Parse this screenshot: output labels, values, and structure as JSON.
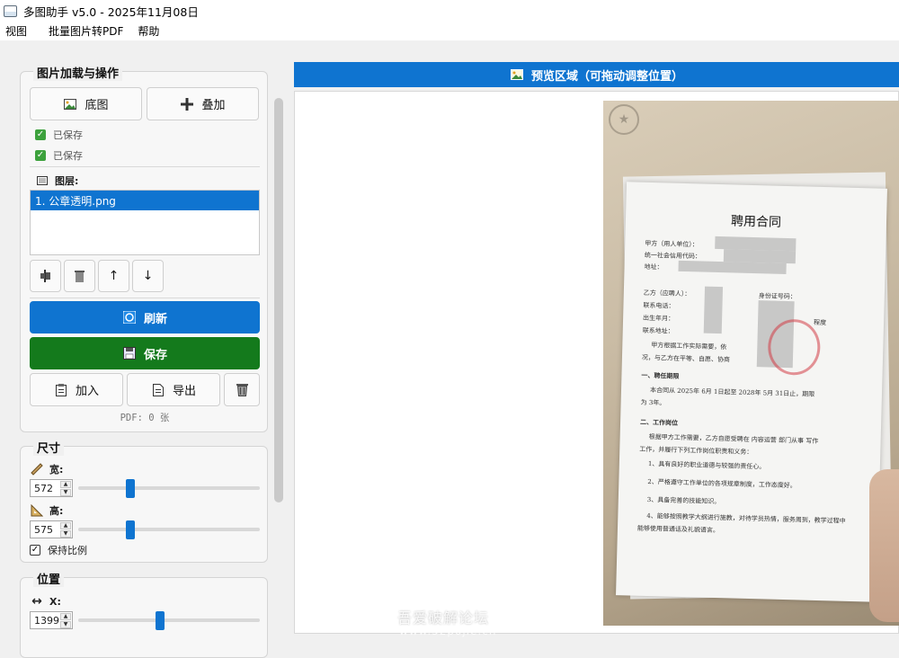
{
  "window": {
    "title": "多图助手 v5.0 - 2025年11月08日"
  },
  "menu": [
    "视图",
    "批量图片转PDF",
    "帮助"
  ],
  "ops_group": {
    "title": "图片加载与操作",
    "base_label": "底图",
    "overlay_label": "叠加",
    "saved_1": "已保存",
    "saved_2": "已保存",
    "layers_label": "图层:",
    "layers": [
      "1. 公章透明.png"
    ],
    "refresh_label": "刷新",
    "save_label": "保存",
    "add_label": "加入",
    "export_label": "导出",
    "pdf_count": "PDF: 0 张"
  },
  "size_group": {
    "title": "尺寸",
    "width_label": "宽:",
    "width_value": "572",
    "width_slider_fraction": 0.29,
    "height_label": "高:",
    "height_value": "575",
    "height_slider_fraction": 0.29,
    "keep_ratio_label": "保持比例",
    "keep_ratio_checked": true
  },
  "position_group": {
    "title": "位置",
    "x_label": "X:",
    "x_value": "1399",
    "x_slider_fraction": 0.45
  },
  "preview": {
    "header": "预览区域（可拖动调整位置）",
    "document": {
      "title": "聘用合同",
      "lines": [
        "甲方（用人单位）：",
        "统一社会信用代码：",
        "地址：",
        "乙方（应聘人）：",
        "联系电话：",
        "出生年月：",
        "联系地址：",
        "甲方根据工作实际需要，依",
        "况，与乙方在平等、自愿、协商",
        "一、聘任期限",
        "本合同从  2025年  6月  1日起至  2028年  5月  31日止，期限",
        "为  3年。",
        "二、工作岗位",
        "根据甲方工作需要，乙方自愿受聘在  内容运营  部门从事  写作",
        "工作，并履行下列工作岗位职责和义务：",
        "1、具有良好的职业道德与较强的责任心。",
        "2、严格遵守工作单位的各项规章制度，工作态度好。",
        "3、具备完善的技能知识。",
        "4、能够按照教学大纲进行施教，对待学员热情，服务周到，教学过程中",
        "能够使用普通话及礼貌语言。"
      ],
      "side_labels": {
        "id_number": "身份证号码：",
        "degree": "程度"
      }
    },
    "watermark": "吾爱破解论坛",
    "watermark_url": "www.52pojie.cn"
  }
}
